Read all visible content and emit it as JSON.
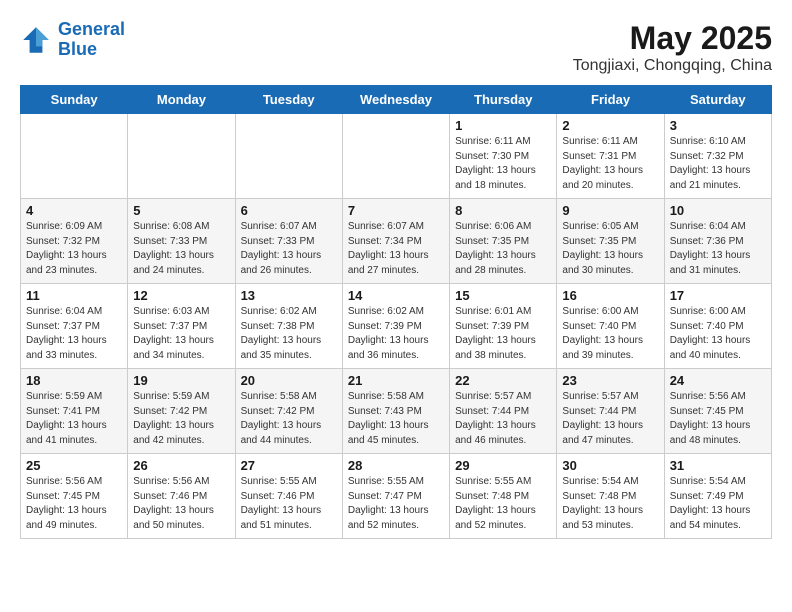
{
  "header": {
    "logo_line1": "General",
    "logo_line2": "Blue",
    "month": "May 2025",
    "location": "Tongjiaxi, Chongqing, China"
  },
  "weekdays": [
    "Sunday",
    "Monday",
    "Tuesday",
    "Wednesday",
    "Thursday",
    "Friday",
    "Saturday"
  ],
  "weeks": [
    [
      {
        "day": "",
        "info": ""
      },
      {
        "day": "",
        "info": ""
      },
      {
        "day": "",
        "info": ""
      },
      {
        "day": "",
        "info": ""
      },
      {
        "day": "1",
        "info": "Sunrise: 6:11 AM\nSunset: 7:30 PM\nDaylight: 13 hours\nand 18 minutes."
      },
      {
        "day": "2",
        "info": "Sunrise: 6:11 AM\nSunset: 7:31 PM\nDaylight: 13 hours\nand 20 minutes."
      },
      {
        "day": "3",
        "info": "Sunrise: 6:10 AM\nSunset: 7:32 PM\nDaylight: 13 hours\nand 21 minutes."
      }
    ],
    [
      {
        "day": "4",
        "info": "Sunrise: 6:09 AM\nSunset: 7:32 PM\nDaylight: 13 hours\nand 23 minutes."
      },
      {
        "day": "5",
        "info": "Sunrise: 6:08 AM\nSunset: 7:33 PM\nDaylight: 13 hours\nand 24 minutes."
      },
      {
        "day": "6",
        "info": "Sunrise: 6:07 AM\nSunset: 7:33 PM\nDaylight: 13 hours\nand 26 minutes."
      },
      {
        "day": "7",
        "info": "Sunrise: 6:07 AM\nSunset: 7:34 PM\nDaylight: 13 hours\nand 27 minutes."
      },
      {
        "day": "8",
        "info": "Sunrise: 6:06 AM\nSunset: 7:35 PM\nDaylight: 13 hours\nand 28 minutes."
      },
      {
        "day": "9",
        "info": "Sunrise: 6:05 AM\nSunset: 7:35 PM\nDaylight: 13 hours\nand 30 minutes."
      },
      {
        "day": "10",
        "info": "Sunrise: 6:04 AM\nSunset: 7:36 PM\nDaylight: 13 hours\nand 31 minutes."
      }
    ],
    [
      {
        "day": "11",
        "info": "Sunrise: 6:04 AM\nSunset: 7:37 PM\nDaylight: 13 hours\nand 33 minutes."
      },
      {
        "day": "12",
        "info": "Sunrise: 6:03 AM\nSunset: 7:37 PM\nDaylight: 13 hours\nand 34 minutes."
      },
      {
        "day": "13",
        "info": "Sunrise: 6:02 AM\nSunset: 7:38 PM\nDaylight: 13 hours\nand 35 minutes."
      },
      {
        "day": "14",
        "info": "Sunrise: 6:02 AM\nSunset: 7:39 PM\nDaylight: 13 hours\nand 36 minutes."
      },
      {
        "day": "15",
        "info": "Sunrise: 6:01 AM\nSunset: 7:39 PM\nDaylight: 13 hours\nand 38 minutes."
      },
      {
        "day": "16",
        "info": "Sunrise: 6:00 AM\nSunset: 7:40 PM\nDaylight: 13 hours\nand 39 minutes."
      },
      {
        "day": "17",
        "info": "Sunrise: 6:00 AM\nSunset: 7:40 PM\nDaylight: 13 hours\nand 40 minutes."
      }
    ],
    [
      {
        "day": "18",
        "info": "Sunrise: 5:59 AM\nSunset: 7:41 PM\nDaylight: 13 hours\nand 41 minutes."
      },
      {
        "day": "19",
        "info": "Sunrise: 5:59 AM\nSunset: 7:42 PM\nDaylight: 13 hours\nand 42 minutes."
      },
      {
        "day": "20",
        "info": "Sunrise: 5:58 AM\nSunset: 7:42 PM\nDaylight: 13 hours\nand 44 minutes."
      },
      {
        "day": "21",
        "info": "Sunrise: 5:58 AM\nSunset: 7:43 PM\nDaylight: 13 hours\nand 45 minutes."
      },
      {
        "day": "22",
        "info": "Sunrise: 5:57 AM\nSunset: 7:44 PM\nDaylight: 13 hours\nand 46 minutes."
      },
      {
        "day": "23",
        "info": "Sunrise: 5:57 AM\nSunset: 7:44 PM\nDaylight: 13 hours\nand 47 minutes."
      },
      {
        "day": "24",
        "info": "Sunrise: 5:56 AM\nSunset: 7:45 PM\nDaylight: 13 hours\nand 48 minutes."
      }
    ],
    [
      {
        "day": "25",
        "info": "Sunrise: 5:56 AM\nSunset: 7:45 PM\nDaylight: 13 hours\nand 49 minutes."
      },
      {
        "day": "26",
        "info": "Sunrise: 5:56 AM\nSunset: 7:46 PM\nDaylight: 13 hours\nand 50 minutes."
      },
      {
        "day": "27",
        "info": "Sunrise: 5:55 AM\nSunset: 7:46 PM\nDaylight: 13 hours\nand 51 minutes."
      },
      {
        "day": "28",
        "info": "Sunrise: 5:55 AM\nSunset: 7:47 PM\nDaylight: 13 hours\nand 52 minutes."
      },
      {
        "day": "29",
        "info": "Sunrise: 5:55 AM\nSunset: 7:48 PM\nDaylight: 13 hours\nand 52 minutes."
      },
      {
        "day": "30",
        "info": "Sunrise: 5:54 AM\nSunset: 7:48 PM\nDaylight: 13 hours\nand 53 minutes."
      },
      {
        "day": "31",
        "info": "Sunrise: 5:54 AM\nSunset: 7:49 PM\nDaylight: 13 hours\nand 54 minutes."
      }
    ]
  ]
}
